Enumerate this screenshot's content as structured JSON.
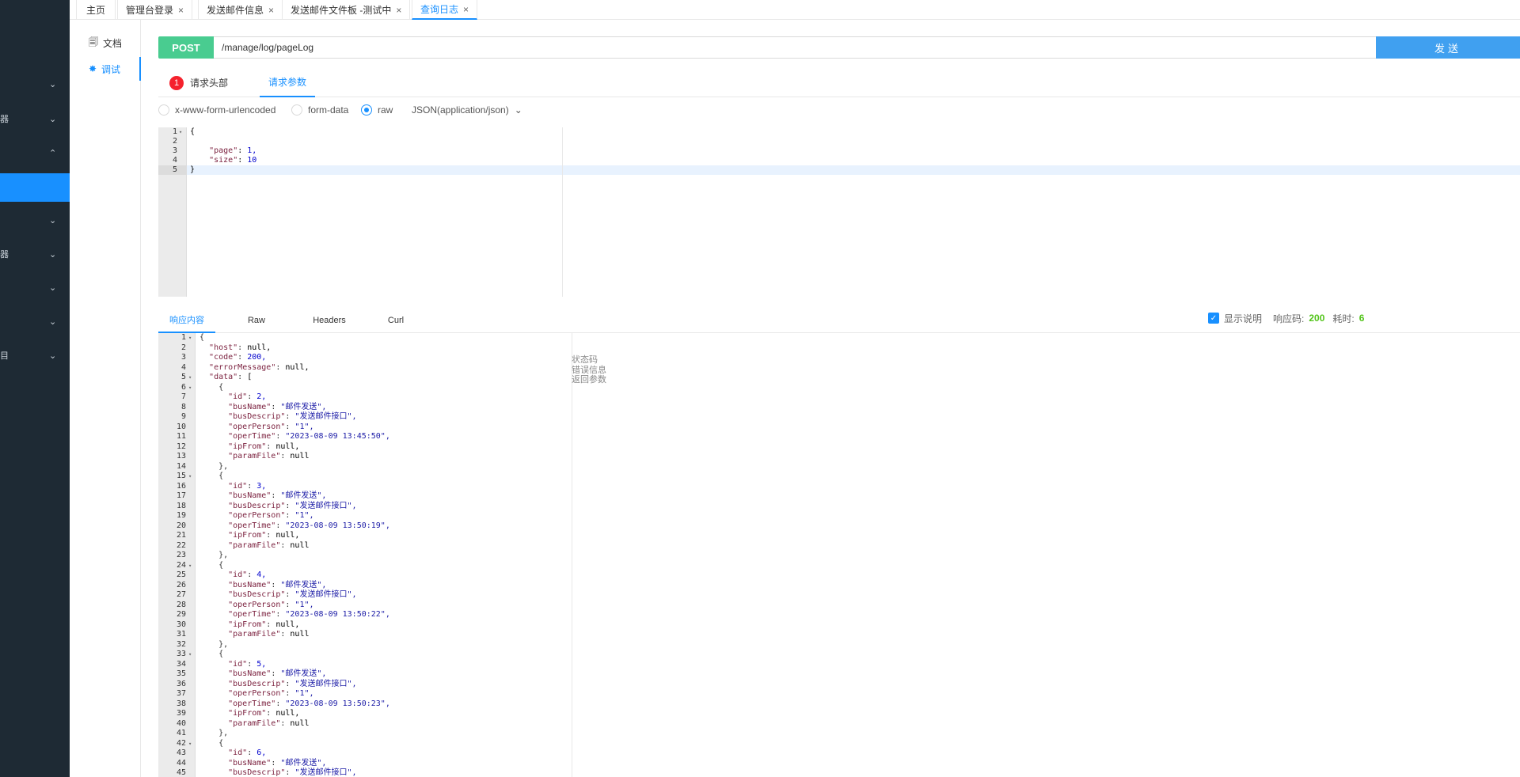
{
  "sidebar": {
    "items": [
      {
        "frag": "",
        "chev": "⌄"
      },
      {
        "frag": "器",
        "chev": "⌄"
      },
      {
        "frag": "",
        "chev": "⌃"
      },
      {
        "frag": "",
        "chev": "⌄"
      },
      {
        "frag": "器",
        "chev": "⌄"
      },
      {
        "frag": "",
        "chev": "⌄"
      },
      {
        "frag": "",
        "chev": "⌄"
      },
      {
        "frag": "目",
        "chev": "⌄"
      }
    ]
  },
  "tabs": [
    {
      "label": "主页"
    },
    {
      "label": "管理台登录",
      "close": "×"
    },
    {
      "label": "发送邮件信息",
      "close": "×"
    },
    {
      "label": "发送邮件文件板 -测试中",
      "close": "×"
    },
    {
      "label": "查询日志",
      "close": "×"
    }
  ],
  "docnav": {
    "doc_icon": "🗐",
    "doc_label": "文档",
    "debug_icon": "✸",
    "debug_label": "调试"
  },
  "request": {
    "method": "POST",
    "url": "/manage/log/pageLog",
    "send_label": "发送"
  },
  "req_tabs": {
    "headers_badge": "1",
    "headers_label": "请求头部",
    "params_label": "请求参数"
  },
  "body_types": {
    "urlencoded": "x-www-form-urlencoded",
    "formdata": "form-data",
    "raw": "raw",
    "content_type": "JSON(application/json)",
    "caret": "⌄"
  },
  "request_body": {
    "line_numbers": [
      "1",
      "2",
      "3",
      "4",
      "5"
    ],
    "lines": [
      "{",
      "",
      "    \"page\": 1,",
      "    \"size\": 10",
      "}"
    ]
  },
  "resp_tabs": {
    "content": "响应内容",
    "raw": "Raw",
    "headers": "Headers",
    "curl": "Curl"
  },
  "resp_meta": {
    "check": "✓",
    "show_desc": "显示说明",
    "code_label": "响应码:",
    "code_value": "200",
    "time_label": "耗时:",
    "time_value": "6"
  },
  "notes": [
    "状态码",
    "错误信息",
    "返回参数"
  ],
  "response": {
    "line_numbers": [
      "1",
      "2",
      "3",
      "4",
      "5",
      "6",
      "7",
      "8",
      "9",
      "10",
      "11",
      "12",
      "13",
      "14",
      "15",
      "16",
      "17",
      "18",
      "19",
      "20",
      "21",
      "22",
      "23",
      "24",
      "25",
      "26",
      "27",
      "28",
      "29",
      "30",
      "31",
      "32",
      "33",
      "34",
      "35",
      "36",
      "37",
      "38",
      "39",
      "40",
      "41",
      "42",
      "43",
      "44",
      "45"
    ],
    "lines": [
      "{",
      "  \"host\": null,",
      "  \"code\": 200,",
      "  \"errorMessage\": null,",
      "  \"data\": [",
      "    {",
      "      \"id\": 2,",
      "      \"busName\": \"邮件发送\",",
      "      \"busDescrip\": \"发送邮件接口\",",
      "      \"operPerson\": \"1\",",
      "      \"operTime\": \"2023-08-09 13:45:50\",",
      "      \"ipFrom\": null,",
      "      \"paramFile\": null",
      "    },",
      "    {",
      "      \"id\": 3,",
      "      \"busName\": \"邮件发送\",",
      "      \"busDescrip\": \"发送邮件接口\",",
      "      \"operPerson\": \"1\",",
      "      \"operTime\": \"2023-08-09 13:50:19\",",
      "      \"ipFrom\": null,",
      "      \"paramFile\": null",
      "    },",
      "    {",
      "      \"id\": 4,",
      "      \"busName\": \"邮件发送\",",
      "      \"busDescrip\": \"发送邮件接口\",",
      "      \"operPerson\": \"1\",",
      "      \"operTime\": \"2023-08-09 13:50:22\",",
      "      \"ipFrom\": null,",
      "      \"paramFile\": null",
      "    },",
      "    {",
      "      \"id\": 5,",
      "      \"busName\": \"邮件发送\",",
      "      \"busDescrip\": \"发送邮件接口\",",
      "      \"operPerson\": \"1\",",
      "      \"operTime\": \"2023-08-09 13:50:23\",",
      "      \"ipFrom\": null,",
      "      \"paramFile\": null",
      "    },",
      "    {",
      "      \"id\": 6,",
      "      \"busName\": \"邮件发送\",",
      "      \"busDescrip\": \"发送邮件接口\","
    ]
  }
}
